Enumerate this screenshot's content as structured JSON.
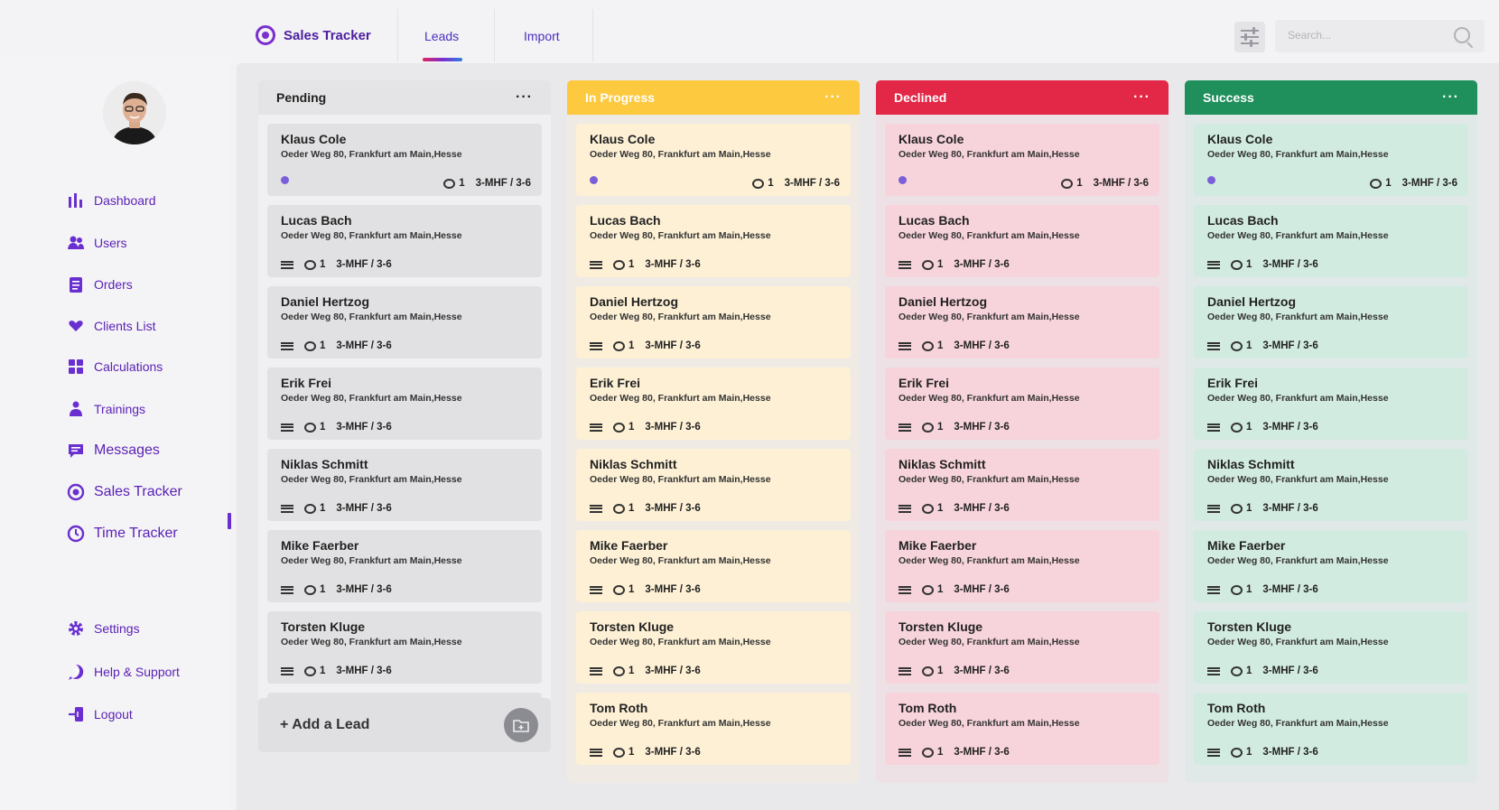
{
  "app": {
    "name": "Sales Tracker"
  },
  "tabs": [
    {
      "label": "Leads"
    },
    {
      "label": "Import"
    }
  ],
  "search": {
    "placeholder": "Search..."
  },
  "icons": {
    "brand": "target-icon",
    "filter": "sliders-icon",
    "search": "search-icon"
  },
  "sidebar": {
    "items": [
      {
        "label": "Dashboard",
        "icon": "chart-bars-icon",
        "glyph": "▮"
      },
      {
        "label": "Users",
        "icon": "users-icon",
        "glyph": "👥"
      },
      {
        "label": "Orders",
        "icon": "clipboard-icon",
        "glyph": "▤"
      },
      {
        "label": "Clients List",
        "icon": "heart-hand-icon",
        "glyph": "♥"
      },
      {
        "label": "Calculations",
        "icon": "calculator-icon",
        "glyph": "▦"
      },
      {
        "label": "Trainings",
        "icon": "trainer-icon",
        "glyph": "☗"
      },
      {
        "label": "Messages",
        "icon": "message-icon",
        "glyph": "▬"
      },
      {
        "label": "Sales Tracker",
        "icon": "target-icon",
        "glyph": "◎"
      },
      {
        "label": "Time Tracker",
        "icon": "clock-icon",
        "glyph": "◷"
      }
    ],
    "bottom": [
      {
        "label": "Settings",
        "icon": "gear-icon",
        "glyph": "⚙"
      },
      {
        "label": "Help & Support",
        "icon": "help-icon",
        "glyph": "?"
      },
      {
        "label": "Logout",
        "icon": "logout-icon",
        "glyph": "⇥"
      }
    ]
  },
  "columns": [
    {
      "title": "Pending",
      "color": "#e4e4e6",
      "text_color": "#222222",
      "card_color": "#e1e1e3"
    },
    {
      "title": "In Progress",
      "color": "#fcc93f",
      "text_color": "#ffffff",
      "card_color": "#fdf0d5"
    },
    {
      "title": "Declined",
      "color": "#e22747",
      "text_color": "#ffffff",
      "card_color": "#f7d3db"
    },
    {
      "title": "Success",
      "color": "#1f8f5c",
      "text_color": "#ffffff",
      "card_color": "#d2ebe0"
    }
  ],
  "column_menu": "···",
  "cards": [
    {
      "name": "Klaus Cole",
      "address": "Oeder Weg 80, Frankfurt am Main,Hesse",
      "comments": "1",
      "code": "3-MHF / 3-6",
      "variant": "dot"
    },
    {
      "name": "Lucas Bach",
      "address": "Oeder Weg 80, Frankfurt am Main,Hesse",
      "comments": "1",
      "code": "3-MHF / 3-6",
      "variant": "lines"
    },
    {
      "name": "Daniel Hertzog",
      "address": "Oeder Weg 80, Frankfurt am Main,Hesse",
      "comments": "1",
      "code": "3-MHF / 3-6",
      "variant": "lines"
    },
    {
      "name": "Erik Frei",
      "address": "Oeder Weg 80, Frankfurt am Main,Hesse",
      "comments": "1",
      "code": "3-MHF / 3-6",
      "variant": "lines"
    },
    {
      "name": "Niklas Schmitt",
      "address": "Oeder Weg 80, Frankfurt am Main,Hesse",
      "comments": "1",
      "code": "3-MHF / 3-6",
      "variant": "lines"
    },
    {
      "name": "Mike Faerber",
      "address": "Oeder Weg 80, Frankfurt am Main,Hesse",
      "comments": "1",
      "code": "3-MHF / 3-6",
      "variant": "lines"
    },
    {
      "name": "Torsten Kluge",
      "address": "Oeder Weg 80, Frankfurt am Main,Hesse",
      "comments": "1",
      "code": "3-MHF / 3-6",
      "variant": "lines"
    },
    {
      "name": "Tom Roth",
      "address": "Oeder Weg 80, Frankfurt am Main,Hesse",
      "comments": "1",
      "code": "3-MHF / 3-6",
      "variant": "lines"
    }
  ],
  "add_lead": {
    "label": "+ Add a Lead",
    "icon": "folder-plus-icon",
    "glyph": "⊞"
  }
}
